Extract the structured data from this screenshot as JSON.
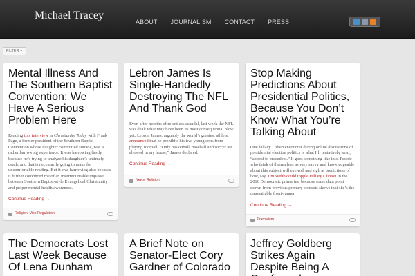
{
  "site": {
    "title": "Michael Tracey"
  },
  "nav": {
    "items": [
      "ABOUT",
      "JOURNALISM",
      "CONTACT",
      "PRESS"
    ]
  },
  "social": {
    "icons": [
      {
        "name": "twitter-icon",
        "color": "#4a90c8"
      },
      {
        "name": "email-icon",
        "color": "#8a9aab"
      },
      {
        "name": "rss-icon",
        "color": "#e8822a"
      }
    ]
  },
  "filter": {
    "label": "FILTER"
  },
  "posts": [
    {
      "title": "Mental Illness And The Southern Baptist Convention: We Have A Serious Problem Here",
      "body": {
        "p1": "Reading ",
        "link1": "this interview",
        "p2": " in ",
        "pub": "Christianity Today",
        "p3": " with Frank Page, a former president of the Southern Baptist Convention whose daughter committed suicide, was a rather harrowing experience. It was harrowing firstly because he’s trying to analyze his daughter’s untimely death, and that is necessarily going to make for uncomfortable reading. But it was harrowing also because it further convinced me of an insurmountable impasse between Southern Baptist-style Evangelical Christianity and proper mental health awareness."
      },
      "continue": "Continue Reading →",
      "tags": [
        "Religion",
        "Vice Regulation"
      ]
    },
    {
      "title": "Lebron James Is Single-Handedly Destroying The NFL And Thank God",
      "body": {
        "p1": "Even after months of relentless scandal, last week the NFL was dealt what may have been its most consequential blow yet. Lebron James, arguably the world’s greatest athlete, ",
        "link1": "announced",
        "p2": " that he prohibits his two young sons from playing football. “Only basketball, baseball and soccer are allowed in my house,” James declared."
      },
      "continue": "Continue Reading →",
      "tags": [
        "News",
        "Religion"
      ]
    },
    {
      "title": "Stop Making Predictions About Presidential Politics, Because You Don’t Know What You’re Talking About",
      "body": {
        "p1": "One fallacy I often encounter during online discussions of presidential election politics is what I’ll tentatively term, “appeal to precedent.” It goes something like this: People who think of themselves as very savvy and knowledgeable about this subject will eye-roll and sigh at predictions of how, say, ",
        "link1": "Jim Webb could topple Hillary Clinton",
        "p2": " in the 2016 Democratic primaries, because some data point drawn from previous primary contests shows that she’s the unassailable front-runner."
      },
      "continue": "Continue Reading →",
      "tags": [
        "Journalism"
      ]
    },
    {
      "title": "The Democrats Lost Last Week Because Of Lena Dunham"
    },
    {
      "title": "A Brief Note on Senator-Elect Cory Gardner of Colorado"
    },
    {
      "title": "Jeffrey Goldberg Strikes Again Despite Being A Confirmed"
    }
  ]
}
